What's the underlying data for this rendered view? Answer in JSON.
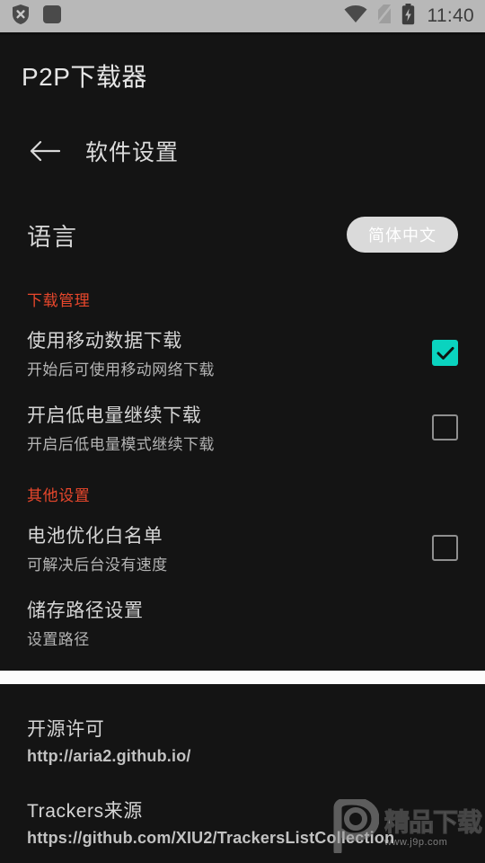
{
  "statusbar": {
    "icons_left": [
      "shield-x-icon",
      "rounded-square-icon"
    ],
    "icons_right": [
      "wifi-icon",
      "sim-off-icon",
      "battery-charging-icon"
    ],
    "clock": "11:40"
  },
  "appbar": {
    "title": "P2P下载器"
  },
  "subbar": {
    "back_icon": "back-arrow-icon",
    "title": "软件设置"
  },
  "language": {
    "label": "语言",
    "value": "简体中文"
  },
  "sections": [
    {
      "header": "下载管理",
      "rows": [
        {
          "title": "使用移动数据下载",
          "subtitle": "开始后可使用移动网络下载",
          "checkbox": true,
          "checked": true
        },
        {
          "title": "开启低电量继续下载",
          "subtitle": "开启后低电量模式继续下载",
          "checkbox": true,
          "checked": false
        }
      ]
    },
    {
      "header": "其他设置",
      "rows": [
        {
          "title": "电池优化白名单",
          "subtitle": "可解决后台没有速度",
          "checkbox": true,
          "checked": false
        },
        {
          "title": "储存路径设置",
          "subtitle": "设置路径",
          "checkbox": false,
          "checked": false
        }
      ]
    }
  ],
  "about": {
    "items": [
      {
        "title": "开源许可",
        "subtitle": "http://aria2.github.io/"
      },
      {
        "title": "Trackers来源",
        "subtitle": "https://github.com/XIU2/TrackersListCollection"
      }
    ]
  },
  "watermark": {
    "brand": "精品下载",
    "url": "www.j9p.com",
    "logo": "p-logo-icon"
  },
  "colors": {
    "background": "#141414",
    "statusbar": "#b8b8b8",
    "accent_section": "#e8472c",
    "checkbox_checked": "#0ad3bf",
    "chip": "#dadada"
  }
}
